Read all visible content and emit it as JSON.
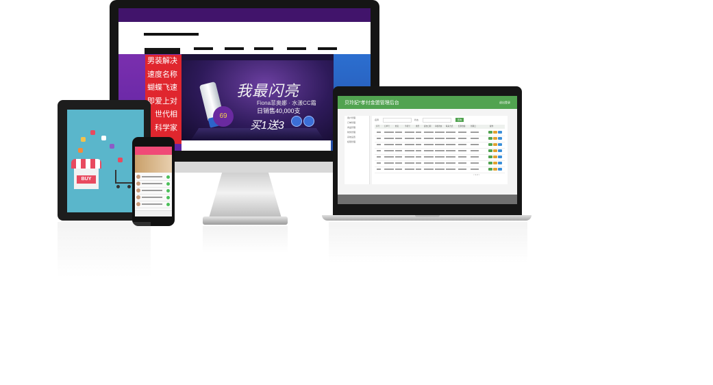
{
  "monitor": {
    "side_panel_lines": [
      "男装解决",
      "速度名称",
      "蝴蝶飞速",
      "即爱上对",
      "世代相",
      "科学家"
    ],
    "banner": {
      "title": "我最闪亮",
      "subtitle": "Fiona菲奥娜 · 水漾CC霜",
      "sales": "日销售40,000支",
      "promo": "买1送3",
      "badge": "69"
    }
  },
  "tablet": {
    "buy_label": "BUY"
  },
  "laptop": {
    "admin_title": "贝玲妃*孝付金盟管理后台",
    "logout": "退出登录",
    "search_label_1": "名称",
    "search_label_2": "状态",
    "search_button": "查询",
    "sidebar_items": [
      "用户管理",
      "订单管理",
      "商品管理",
      "财务管理",
      "系统设置",
      "权限管理"
    ],
    "table_headers": [
      "序号",
      "订单号",
      "姓名",
      "手机号",
      "类型",
      "提交日期",
      "审核状态",
      "联系方式",
      "结算金额",
      "到期日",
      "操作"
    ],
    "pager": "< 1 2 >"
  },
  "colors": {
    "site_topbar": "#41146b",
    "red_panel": "#e0262e",
    "admin_green": "#51a350",
    "phone_pink": "#f04a77",
    "tablet_bg": "#5ab6cb"
  }
}
